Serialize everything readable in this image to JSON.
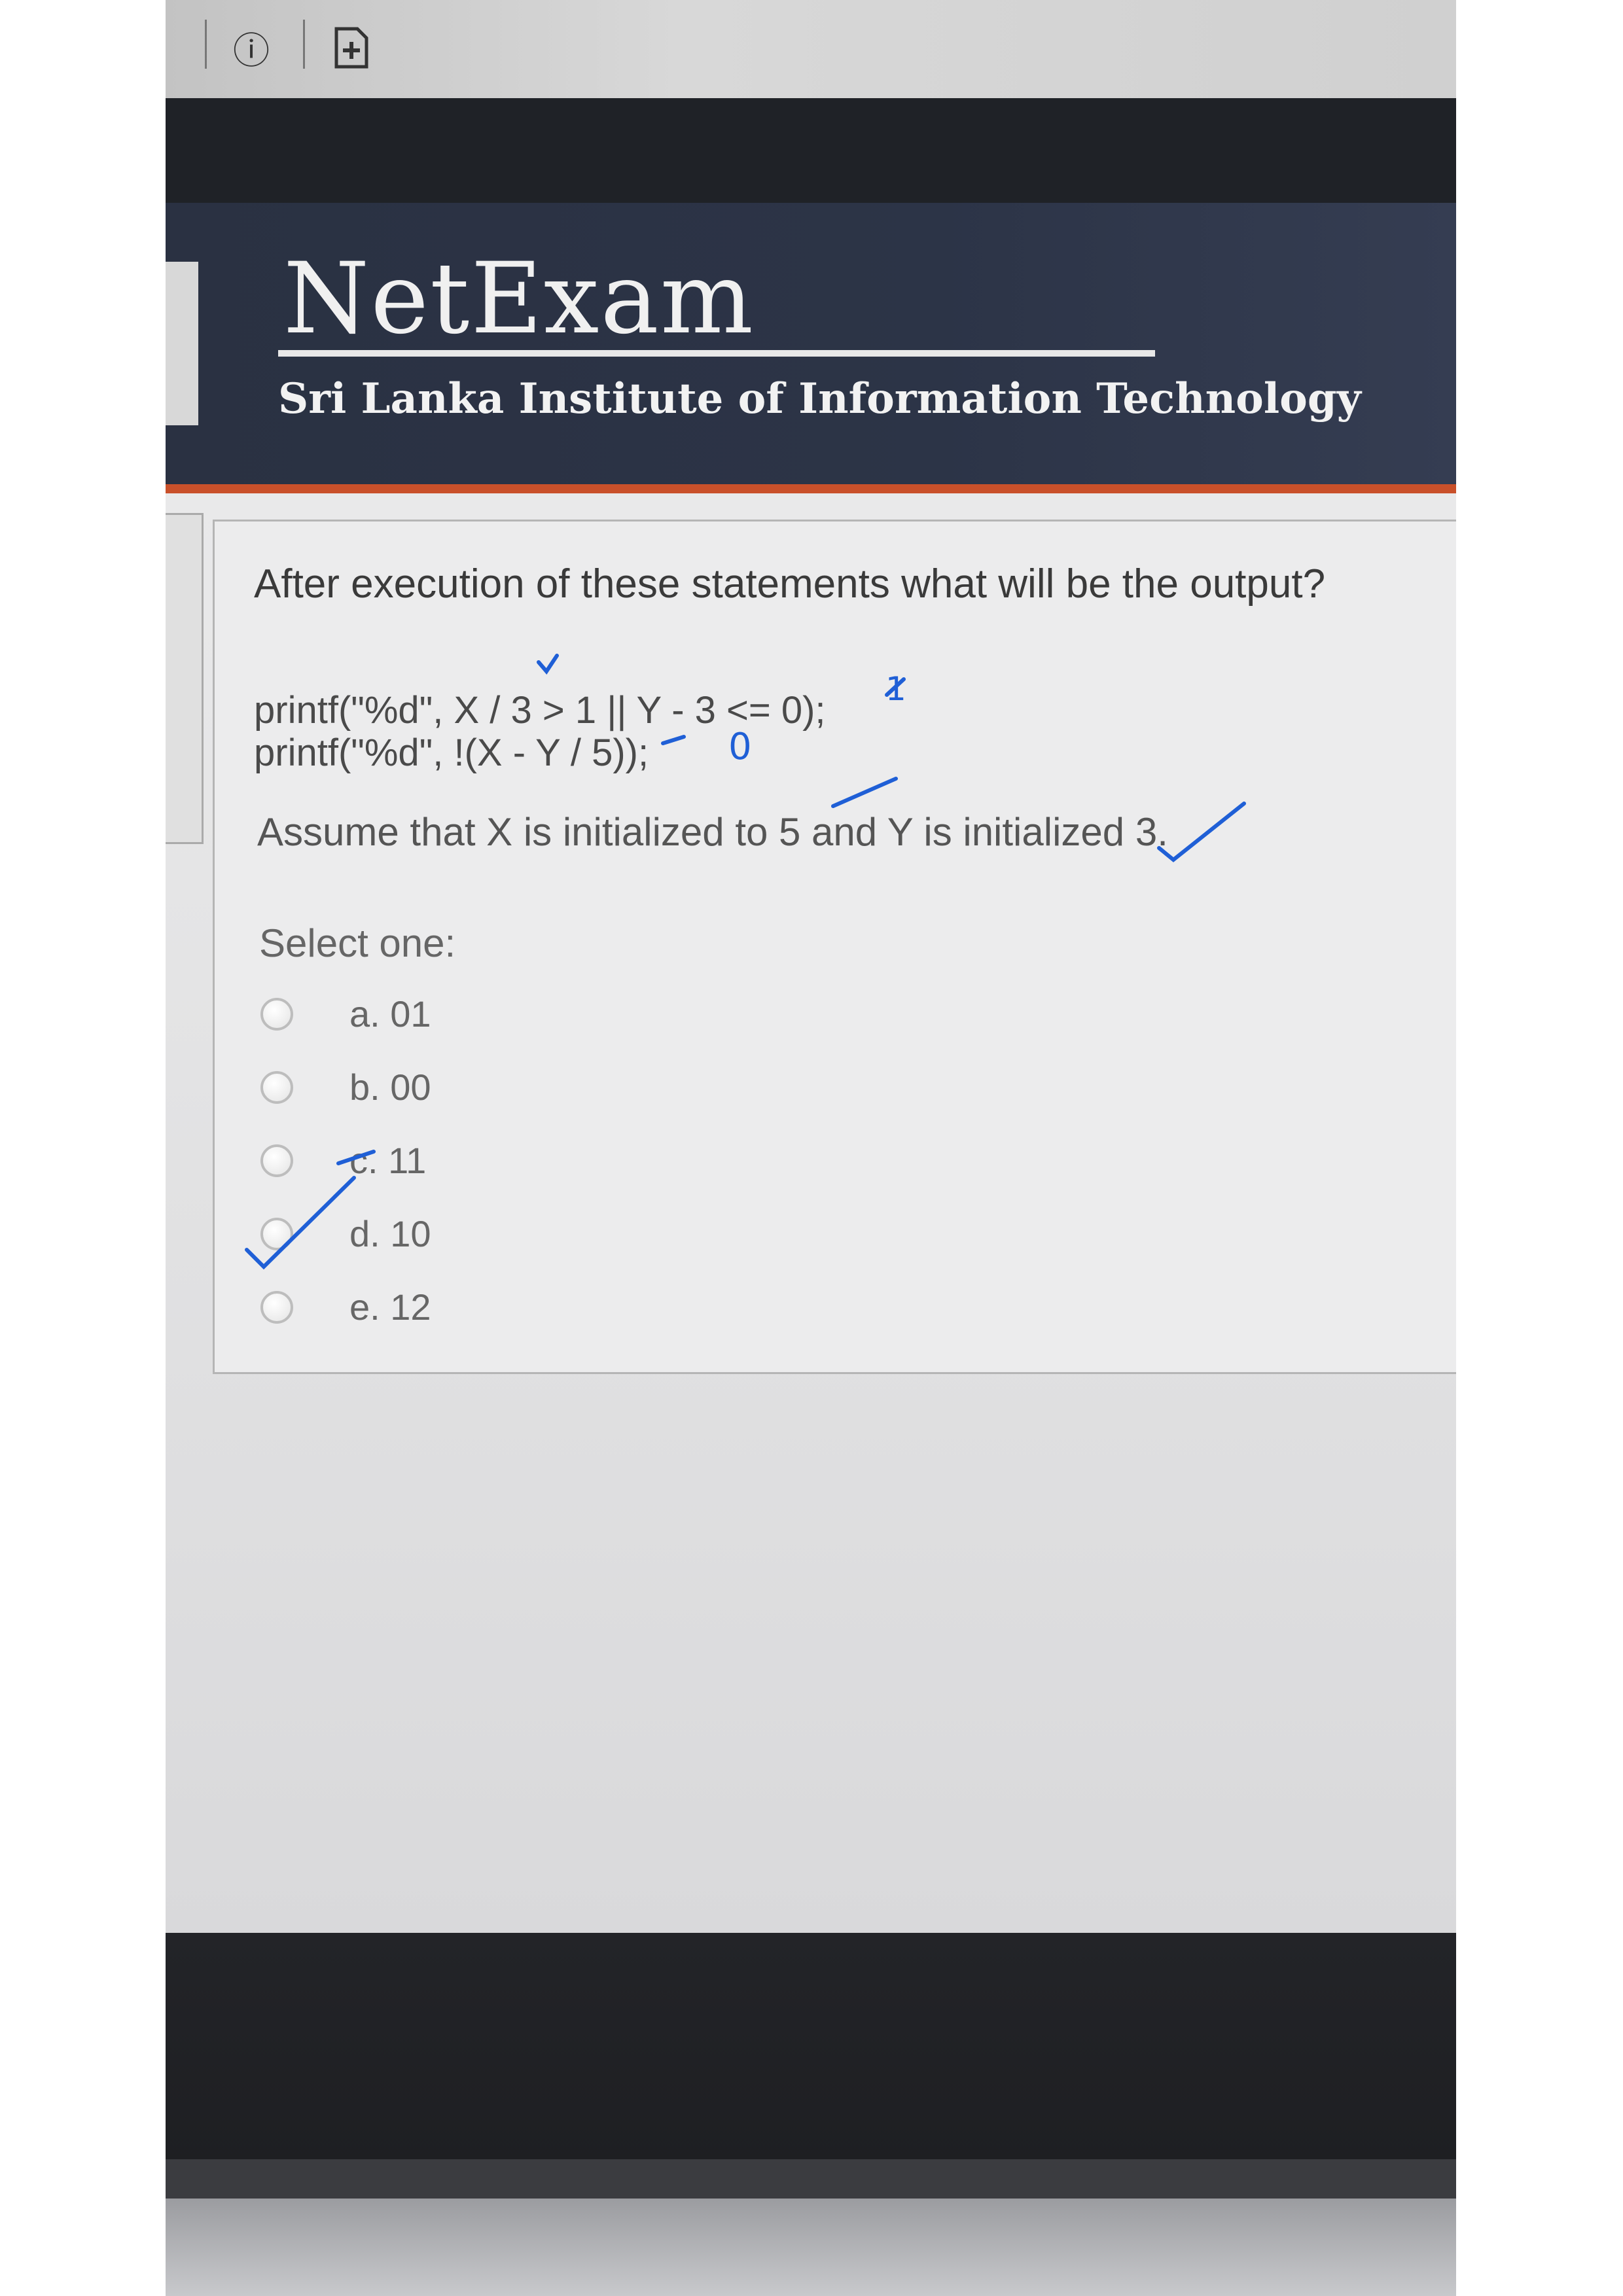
{
  "header": {
    "brand": "NetExam",
    "institute": "Sri Lanka Institute of Information Technology"
  },
  "question": {
    "prompt": "After execution of these statements what will be the output?",
    "code_line_1": "printf(\"%d\", X / 3 > 1 || Y - 3 <= 0);",
    "code_line_2": "printf(\"%d\", !(X - Y / 5));",
    "assumption": "Assume that X is initialized to 5 and Y is initialized 3.",
    "select_label": "Select one:",
    "options": [
      {
        "label": "a. 01"
      },
      {
        "label": "b. 00"
      },
      {
        "label": "c. 11"
      },
      {
        "label": "d. 10"
      },
      {
        "label": "e. 12"
      }
    ]
  },
  "annotations": {
    "line1_result": "1",
    "line2_result": "0"
  },
  "colors": {
    "header_bg": "#2c3447",
    "accent_orange": "#c9502a",
    "ink_blue": "#1f5fd6"
  },
  "icons": [
    "info-icon",
    "add-page-icon"
  ]
}
